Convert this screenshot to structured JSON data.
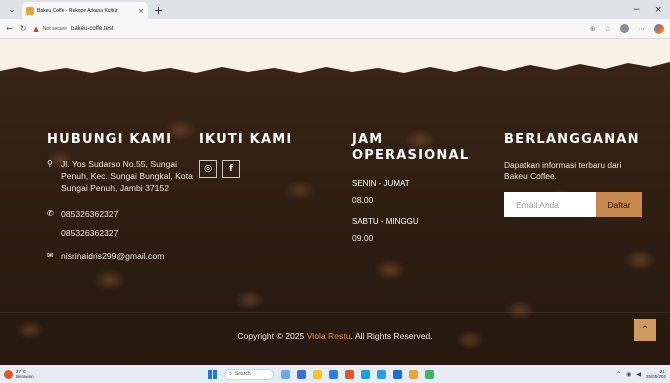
{
  "browser": {
    "tab_title": "Bakeu Coffe - Rekope Arkana Kultur",
    "tab_close_icon": "×",
    "new_tab_icon": "+",
    "menu_icon": "⌄",
    "window_minimize": "−",
    "window_close": "×",
    "back_icon": "←",
    "refresh_icon": "↻",
    "security_icon": "▲",
    "security_label": "Not secure",
    "url": "bakeu-coffe.test",
    "toolbar_icons": [
      "⊕",
      "☆",
      "⋯"
    ]
  },
  "footer": {
    "contact": {
      "heading": "HUBUNGI KAMI",
      "address_icon": "location-pin-icon",
      "address": "Jl. Yos Sudarso No.55, Sungai Penuh, Kec. Sungai Bungkal, Kota Sungai Penuh, Jambi 37152",
      "phone_primary": "085326362327",
      "phone_secondary": "085326362327",
      "email": "nisrinaidris299@gmail.com"
    },
    "follow": {
      "heading": "IKUTI KAMI",
      "instagram_glyph": "◎",
      "facebook_glyph": "f"
    },
    "hours": {
      "heading": "JAM OPERASIONAL",
      "weekday_label": "SENIN - JUMAT",
      "weekday_time": "08.00",
      "weekend_label": "SABTU - MINGGU",
      "weekend_time": "09.00"
    },
    "newsletter": {
      "heading": "BERLANGGANAN",
      "description": "Dapatkan informasi terbaru dari Bakeu Coffee.",
      "email_placeholder": "Email Anda",
      "submit_label": "Daftar"
    },
    "copyright_prefix": "Copyright © 2025 ",
    "copyright_author": "Viola Restu",
    "copyright_suffix": ". All Rights Reserved.",
    "back_to_top_glyph": "⌃"
  },
  "taskbar": {
    "weather_temp": "27°C",
    "weather_desc": "Berawan",
    "search_label": "Search",
    "clock_time": "21:",
    "clock_date": "25/05/202"
  },
  "colors": {
    "accent": "#c8894f",
    "author": "#d48b44",
    "footer_bg": "#2f1e12"
  }
}
